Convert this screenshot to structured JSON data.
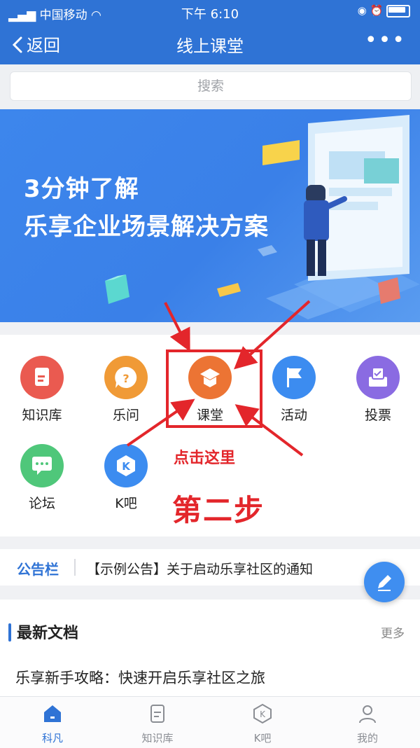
{
  "status_bar": {
    "carrier": "中国移动",
    "time": "下午 6:10"
  },
  "nav": {
    "back_label": "返回",
    "title": "线上课堂",
    "more_label": "•••"
  },
  "search": {
    "placeholder": "搜索"
  },
  "banner": {
    "line1": "3分钟了解",
    "line2": "乐享企业场景解决方案"
  },
  "grid": {
    "items": [
      {
        "label": "知识库",
        "color": "#ea5a50",
        "icon": "document-icon"
      },
      {
        "label": "乐问",
        "color": "#f09a36",
        "icon": "question-icon"
      },
      {
        "label": "课堂",
        "color": "#ec7434",
        "icon": "graduation-cap-icon"
      },
      {
        "label": "活动",
        "color": "#3c8cf0",
        "icon": "flag-icon"
      },
      {
        "label": "投票",
        "color": "#8a6be2",
        "icon": "ballot-box-icon"
      },
      {
        "label": "论坛",
        "color": "#4fc77a",
        "icon": "chat-bubble-icon"
      },
      {
        "label": "K吧",
        "color": "#3c8cf0",
        "icon": "k-hexagon-icon"
      }
    ]
  },
  "annotation": {
    "click_here": "点击这里",
    "step": "第二步",
    "color": "#e3262b"
  },
  "notice": {
    "tag": "公告栏",
    "text": "【示例公告】关于启动乐享社区的通知"
  },
  "docs": {
    "title": "最新文档",
    "more_label": "更多",
    "first_doc": "乐享新手攻略：快速开启乐享社区之旅"
  },
  "tabbar": {
    "tabs": [
      {
        "label": "科凡",
        "icon": "home-icon",
        "active": true
      },
      {
        "label": "知识库",
        "icon": "document-icon",
        "active": false
      },
      {
        "label": "K吧",
        "icon": "k-hexagon-icon",
        "active": false
      },
      {
        "label": "我的",
        "icon": "person-icon",
        "active": false
      }
    ]
  },
  "colors": {
    "primary": "#2f73d5",
    "annotation_red": "#e3262b"
  }
}
